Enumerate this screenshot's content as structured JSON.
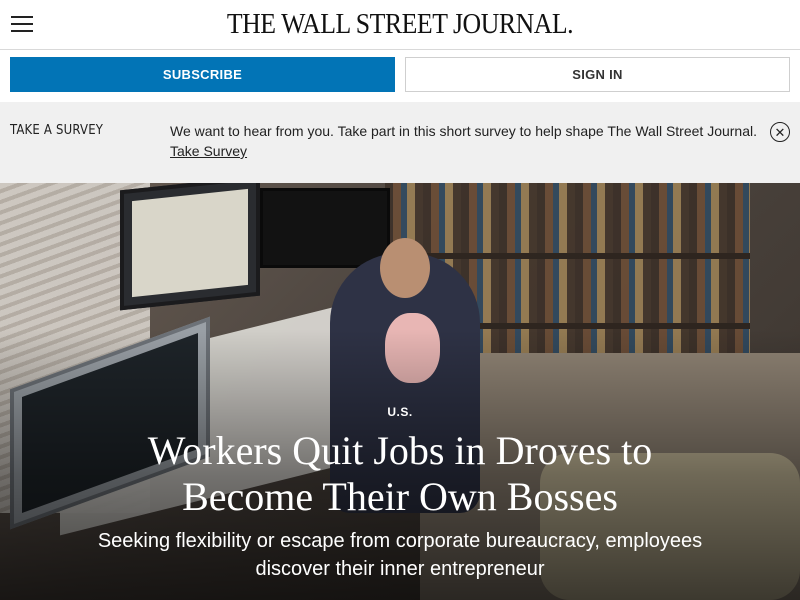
{
  "header": {
    "masthead": "THE WALL STREET JOURNAL.",
    "menu_icon": "hamburger-menu-icon"
  },
  "auth": {
    "subscribe_label": "SUBSCRIBE",
    "signin_label": "SIGN IN",
    "subscribe_color": "#0274b6"
  },
  "survey": {
    "tag": "TAKE A SURVEY",
    "message": "We want to hear from you. Take part in this short survey to help shape The Wall Street Journal.",
    "link_label": "Take Survey",
    "close_icon": "close-circle-icon",
    "close_glyph": "✕"
  },
  "hero": {
    "section": "U.S.",
    "headline": "Workers Quit Jobs in Droves to Become Their Own Bosses",
    "dek": "Seeking flexibility or escape from corporate bureaucracy, employees discover their inner entrepreneur"
  }
}
